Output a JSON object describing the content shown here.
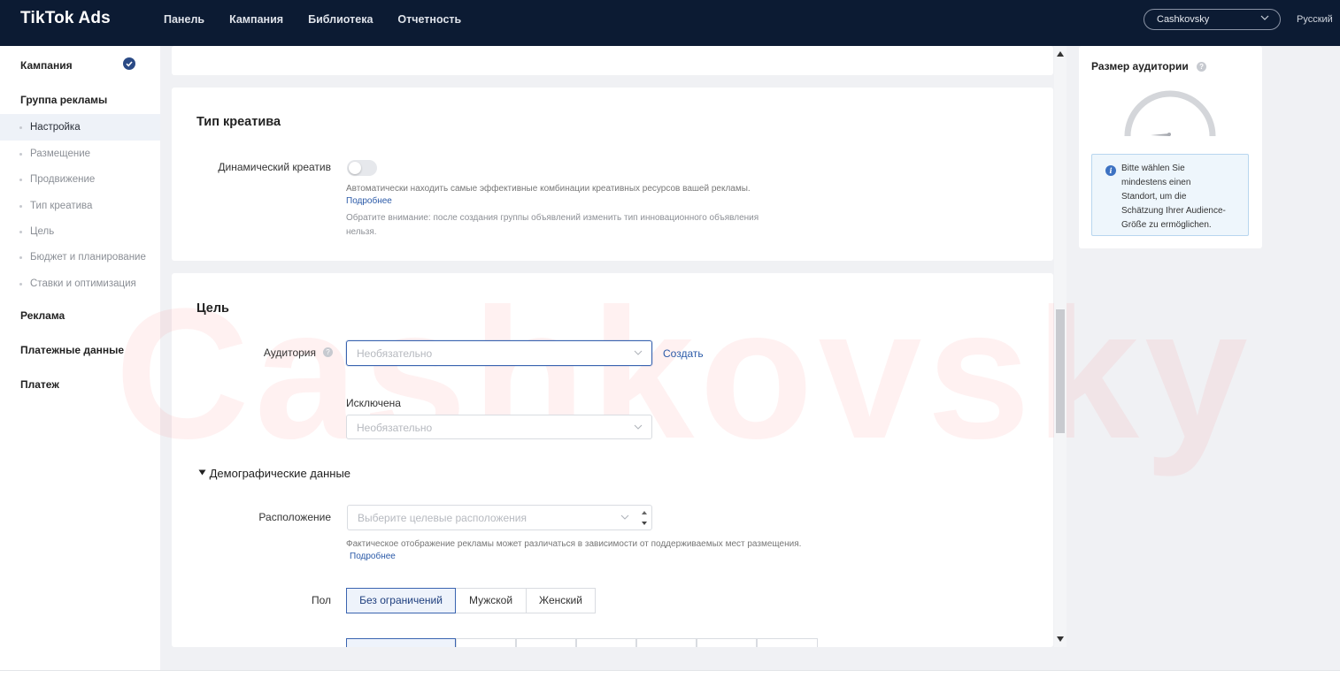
{
  "header": {
    "logo_text": "TikTok Ads",
    "nav": [
      "Панель",
      "Кампания",
      "Библиотека",
      "Отчетность"
    ],
    "account_name": "Cashkovsky",
    "language": "Русский"
  },
  "sidebar": {
    "campaign": "Кампания",
    "ad_group": "Группа рекламы",
    "sub_items": [
      "Настройка",
      "Размещение",
      "Продвижение",
      "Тип креатива",
      "Цель",
      "Бюджет и планирование",
      "Ставки и оптимизация"
    ],
    "ad": "Реклама",
    "billing": "Платежные данные",
    "payment": "Платеж"
  },
  "creative_type": {
    "title": "Тип креатива",
    "dynamic_label": "Динамический креатив",
    "dynamic_on": false,
    "description": "Автоматически находить самые эффективные комбинации креативных ресурсов вашей рекламы.",
    "learn_more": "Подробнее",
    "note_line1": "Обратите внимание: после создания группы объявлений изменить тип инновационного объявления",
    "note_line2": "нельзя."
  },
  "target": {
    "title": "Цель",
    "audience_label": "Аудитория",
    "audience_placeholder": "Необязательно",
    "create_link": "Создать",
    "excluded_label": "Исключена",
    "excluded_placeholder": "Необязательно",
    "demographics_title": "Демографические данные",
    "location_label": "Расположение",
    "location_placeholder": "Выберите целевые расположения",
    "location_note": "Фактическое отображение рекламы может различаться в зависимости от поддерживаемых мест размещения.",
    "location_learn_more": "Подробнее",
    "gender_label": "Пол",
    "gender_options": [
      "Без ограничений",
      "Мужской",
      "Женский"
    ],
    "gender_selected": "Без ограничений"
  },
  "audience_panel": {
    "title": "Размер аудитории",
    "info_line1": "Bitte wählen Sie",
    "info_line2": "mindestens einen",
    "info_line3": "Standort, um die",
    "info_line4": "Schätzung Ihrer Audience-",
    "info_line5": "Größe zu ermöglichen."
  },
  "watermark": "Cashkovsky",
  "colors": {
    "topbar": "#0c1b33",
    "accent": "#3a64b0",
    "link": "#2b5aa8"
  }
}
